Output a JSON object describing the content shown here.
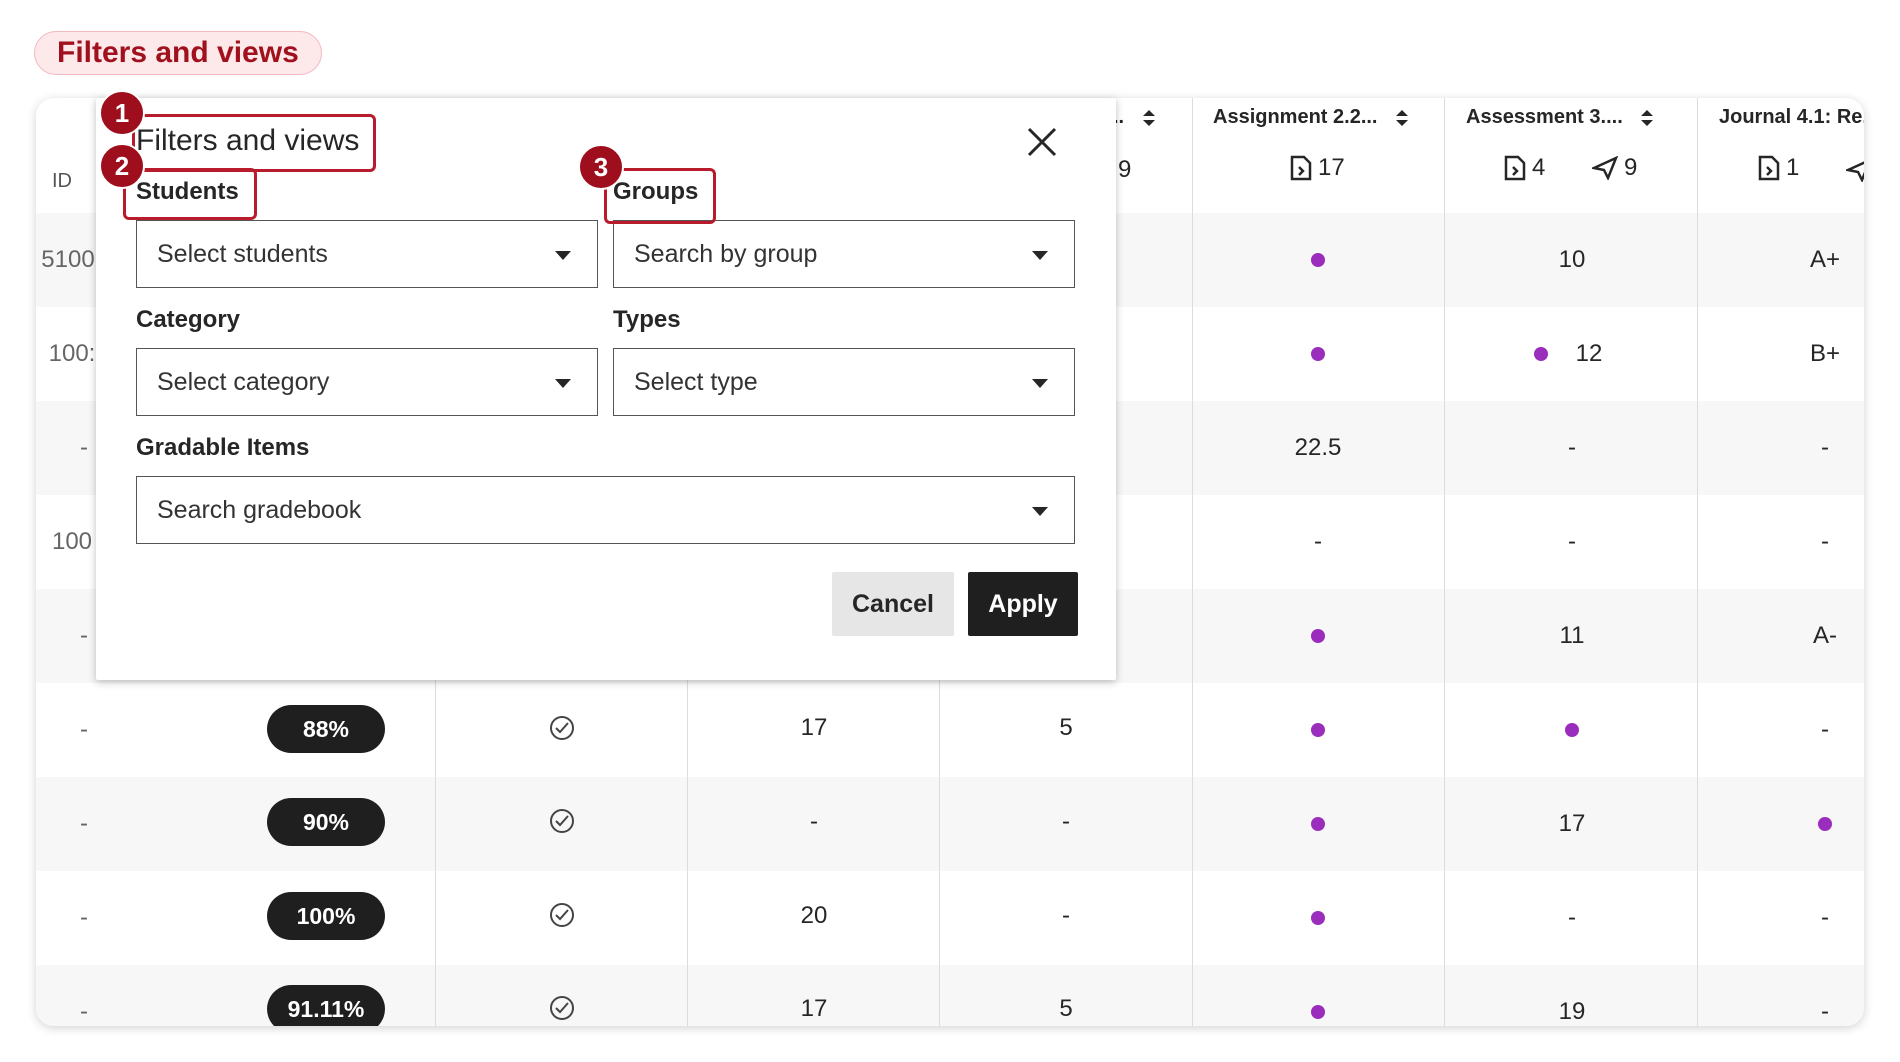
{
  "section_pill": "Filters and views",
  "grid": {
    "id_header": "ID",
    "col_headers": [
      {
        "label": "..",
        "sub_sub": "9"
      },
      {
        "label": "Assignment 2.2...",
        "sub_file": "17"
      },
      {
        "label": "Assessment 3....",
        "sub_file": "4",
        "sub_send": "9"
      },
      {
        "label": "Journal 4.1: Re.",
        "sub_file": "1"
      }
    ],
    "id_values": [
      "5100",
      "100:",
      "-",
      "100",
      "-",
      "-",
      "-",
      "-",
      "-"
    ],
    "grade_badges": [
      "88%",
      "90%",
      "100%",
      "91.11%"
    ],
    "col_c": [
      "17",
      "-",
      "20",
      "17"
    ],
    "col_d": [
      "5",
      "-",
      "-",
      "5"
    ],
    "assignment_row_3": "22.5",
    "assessment": [
      "10",
      "12",
      "-",
      "-",
      "11",
      "",
      "17",
      "-",
      "19"
    ],
    "journal": [
      "A+",
      "B+",
      "-",
      "-",
      "A-",
      "-",
      "",
      "-",
      "-"
    ]
  },
  "dialog": {
    "title": "Filters and views",
    "students_label": "Students",
    "students_placeholder": "Select students",
    "groups_label": "Groups",
    "groups_placeholder": "Search by group",
    "category_label": "Category",
    "category_placeholder": "Select category",
    "types_label": "Types",
    "types_placeholder": "Select type",
    "gradable_label": "Gradable Items",
    "gradable_placeholder": "Search gradebook",
    "cancel_label": "Cancel",
    "apply_label": "Apply"
  },
  "markers": [
    "1",
    "2",
    "3"
  ],
  "colors": {
    "accent": "#9e0e1c",
    "dot": "#9b2dbd",
    "dark": "#1f1f1f"
  }
}
